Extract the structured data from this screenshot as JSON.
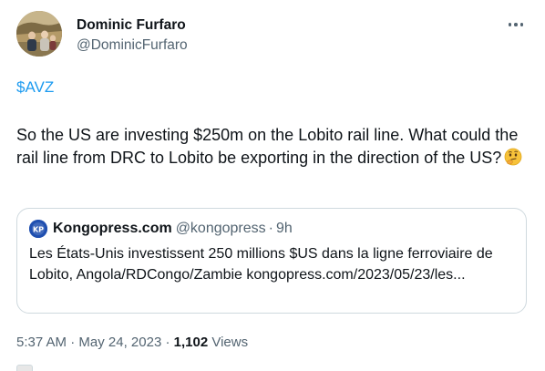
{
  "author": {
    "display_name": "Dominic Furfaro",
    "handle": "@DominicFurfaro"
  },
  "tweet": {
    "cashtag": "$AVZ",
    "text": "So the US are investing $250m on the Lobito rail line. What could the rail line from DRC to Lobito be exporting in the direction of the US?",
    "emoji": "🤔"
  },
  "quote": {
    "name": "Kongopress.com",
    "handle": "@kongopress",
    "separator": "·",
    "time": "9h",
    "text": "Les États-Unis investissent 250 millions $US dans la ligne ferroviaire de Lobito, Angola/RDCongo/Zambie kongopress.com/2023/05/23/les..."
  },
  "meta": {
    "time": "5:37 AM",
    "dot1": "·",
    "date": "May 24, 2023",
    "dot2": "·",
    "views_count": "1,102",
    "views_label": "Views"
  },
  "icons": {
    "more": "more-dots-icon",
    "avatar": "avatar-photo",
    "quote_logo": "kongopress-logo",
    "emoji": "thinking-face-emoji"
  },
  "colors": {
    "link": "#1d9bf0",
    "secondary_text": "#536471",
    "primary_text": "#0f1419",
    "border": "#cfd9de"
  }
}
